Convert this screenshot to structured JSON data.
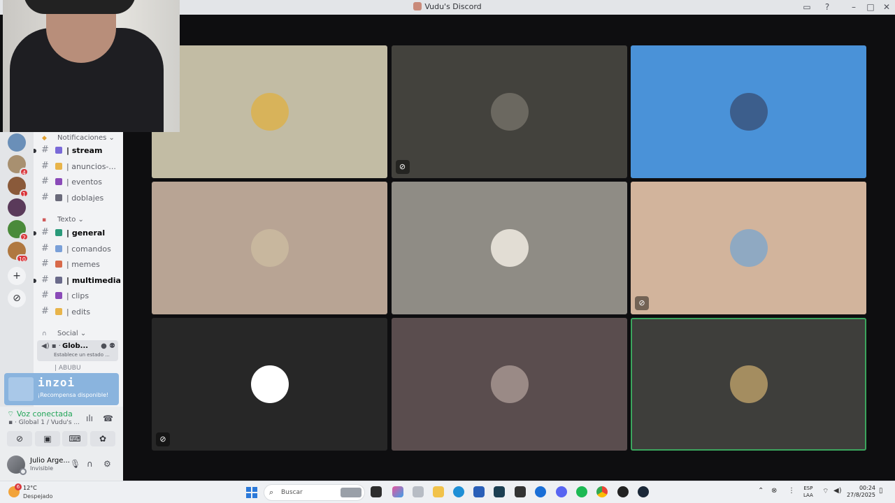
{
  "window": {
    "title": "Vudu's Discord",
    "icons": [
      "inbox-icon",
      "help-icon",
      "minimize-icon",
      "maximize-icon",
      "close-icon"
    ]
  },
  "rail": {
    "servers": [
      {
        "badge": ""
      },
      {
        "badge": "4"
      },
      {
        "badge": "1"
      },
      {
        "badge": ""
      },
      {
        "badge": "2"
      },
      {
        "badge": "10"
      }
    ],
    "add_label": "+",
    "discover_label": "⊘"
  },
  "channels": {
    "categories": {
      "notificaciones": "Notificaciones",
      "texto": "Texto",
      "social": "Social"
    },
    "notif_channels": [
      {
        "name": "| stream",
        "bold": true
      },
      {
        "name": "| anuncios-...",
        "bold": false
      },
      {
        "name": "| eventos",
        "bold": false
      },
      {
        "name": "| doblajes",
        "bold": false
      }
    ],
    "text_channels": [
      {
        "name": "| general",
        "bold": true
      },
      {
        "name": "| comandos",
        "bold": false
      },
      {
        "name": "| memes",
        "bold": false
      },
      {
        "name": "| multimedia",
        "bold": true
      },
      {
        "name": "| clips",
        "bold": false
      },
      {
        "name": "| edits",
        "bold": false
      }
    ],
    "voice_channel": {
      "name": "Glob...",
      "status": "Establece un estado ..."
    },
    "voice_user": "| ABUBU"
  },
  "promo": {
    "logo": "inzoi",
    "text": "¡Recompensa disponible!"
  },
  "voice_panel": {
    "title": "Voz conectada",
    "subtitle": "Global 1 / Vudu's ..."
  },
  "user_panel": {
    "name": "Julio Arge...",
    "status": "Invisible"
  },
  "tiles": [
    {
      "bg": "#c2bca4",
      "avatar": "#d8b35a",
      "muted": false
    },
    {
      "bg": "#43423d",
      "avatar": "#6b6860",
      "muted": true
    },
    {
      "bg": "#4a92d8",
      "avatar": "#3c5e8c",
      "muted": false
    },
    {
      "bg": "#b8a494",
      "avatar": "#c8b79e",
      "muted": false
    },
    {
      "bg": "#8f8c85",
      "avatar": "#e2ddd4",
      "muted": false
    },
    {
      "bg": "#d2b49c",
      "avatar": "#8fa9c2",
      "muted": true
    },
    {
      "bg": "#272727",
      "avatar": "#ffffff",
      "muted": true
    },
    {
      "bg": "#5a4d4e",
      "avatar": "#9a8a86",
      "muted": false
    },
    {
      "bg": "#3e3e3b",
      "avatar": "#a48d60",
      "muted": false,
      "active": true
    }
  ],
  "taskbar": {
    "weather_badge": "6",
    "temp": "12°C",
    "condition": "Despejado",
    "search_placeholder": "Buscar",
    "lang_top": "ESP",
    "lang_bottom": "LAA",
    "time": "00:24",
    "date": "27/8/2025"
  }
}
